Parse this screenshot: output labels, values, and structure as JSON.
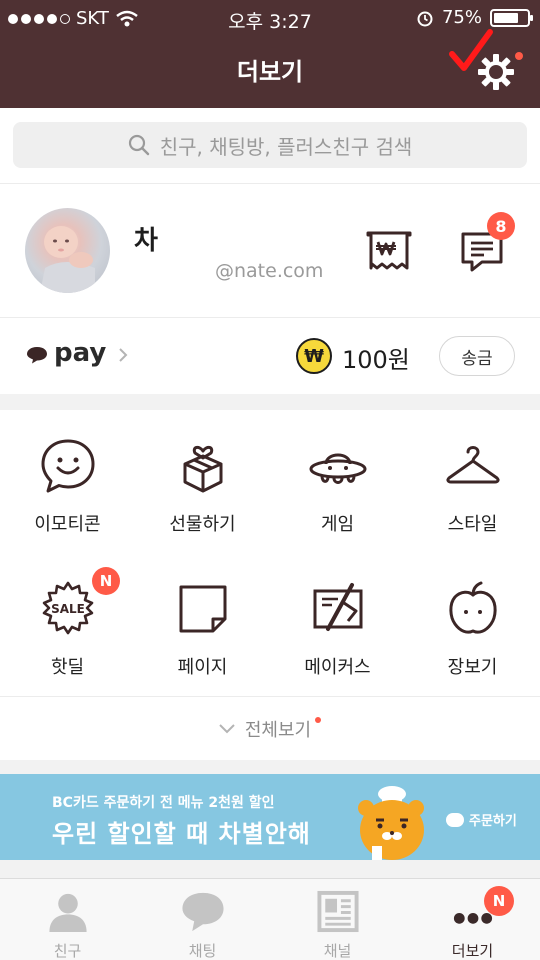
{
  "status_bar": {
    "carrier": "SKT",
    "time": "오후 3:27",
    "battery": "75%",
    "battery_level": 0.75
  },
  "header": {
    "title": "더보기"
  },
  "search": {
    "placeholder": "친구, 채팅방, 플러스친구 검색"
  },
  "profile": {
    "name": "차",
    "email": "@nate.com",
    "message_badge": "8"
  },
  "pay": {
    "label": "pay",
    "coin_symbol": "₩",
    "amount": "100원",
    "send_label": "송금"
  },
  "grid": {
    "items": [
      {
        "label": "이모티콘",
        "icon": "smile-icon"
      },
      {
        "label": "선물하기",
        "icon": "gift-icon"
      },
      {
        "label": "게임",
        "icon": "ufo-icon"
      },
      {
        "label": "스타일",
        "icon": "hanger-icon"
      },
      {
        "label": "핫딜",
        "icon": "sale-icon",
        "badge": "N",
        "sale_text": "SALE"
      },
      {
        "label": "페이지",
        "icon": "page-icon"
      },
      {
        "label": "메이커스",
        "icon": "makers-icon"
      },
      {
        "label": "장보기",
        "icon": "apple-icon"
      }
    ],
    "view_all": "전체보기"
  },
  "banner": {
    "small_text": "BC카드 주문하기 전 메뉴 2천원 할인",
    "big_text": "우린 할인할 때 차별안해",
    "order_label": "주문하기"
  },
  "tabs": [
    {
      "label": "친구",
      "icon": "person-icon"
    },
    {
      "label": "채팅",
      "icon": "chat-bubble-icon"
    },
    {
      "label": "채널",
      "icon": "channel-icon"
    },
    {
      "label": "더보기",
      "icon": "more-dots-icon",
      "badge": "N",
      "active": true
    }
  ],
  "colors": {
    "header_bg": "#4f3133",
    "badge_red": "#ff5a47",
    "banner_bg": "#86c7e1",
    "coin_yellow": "#f6d93b"
  }
}
